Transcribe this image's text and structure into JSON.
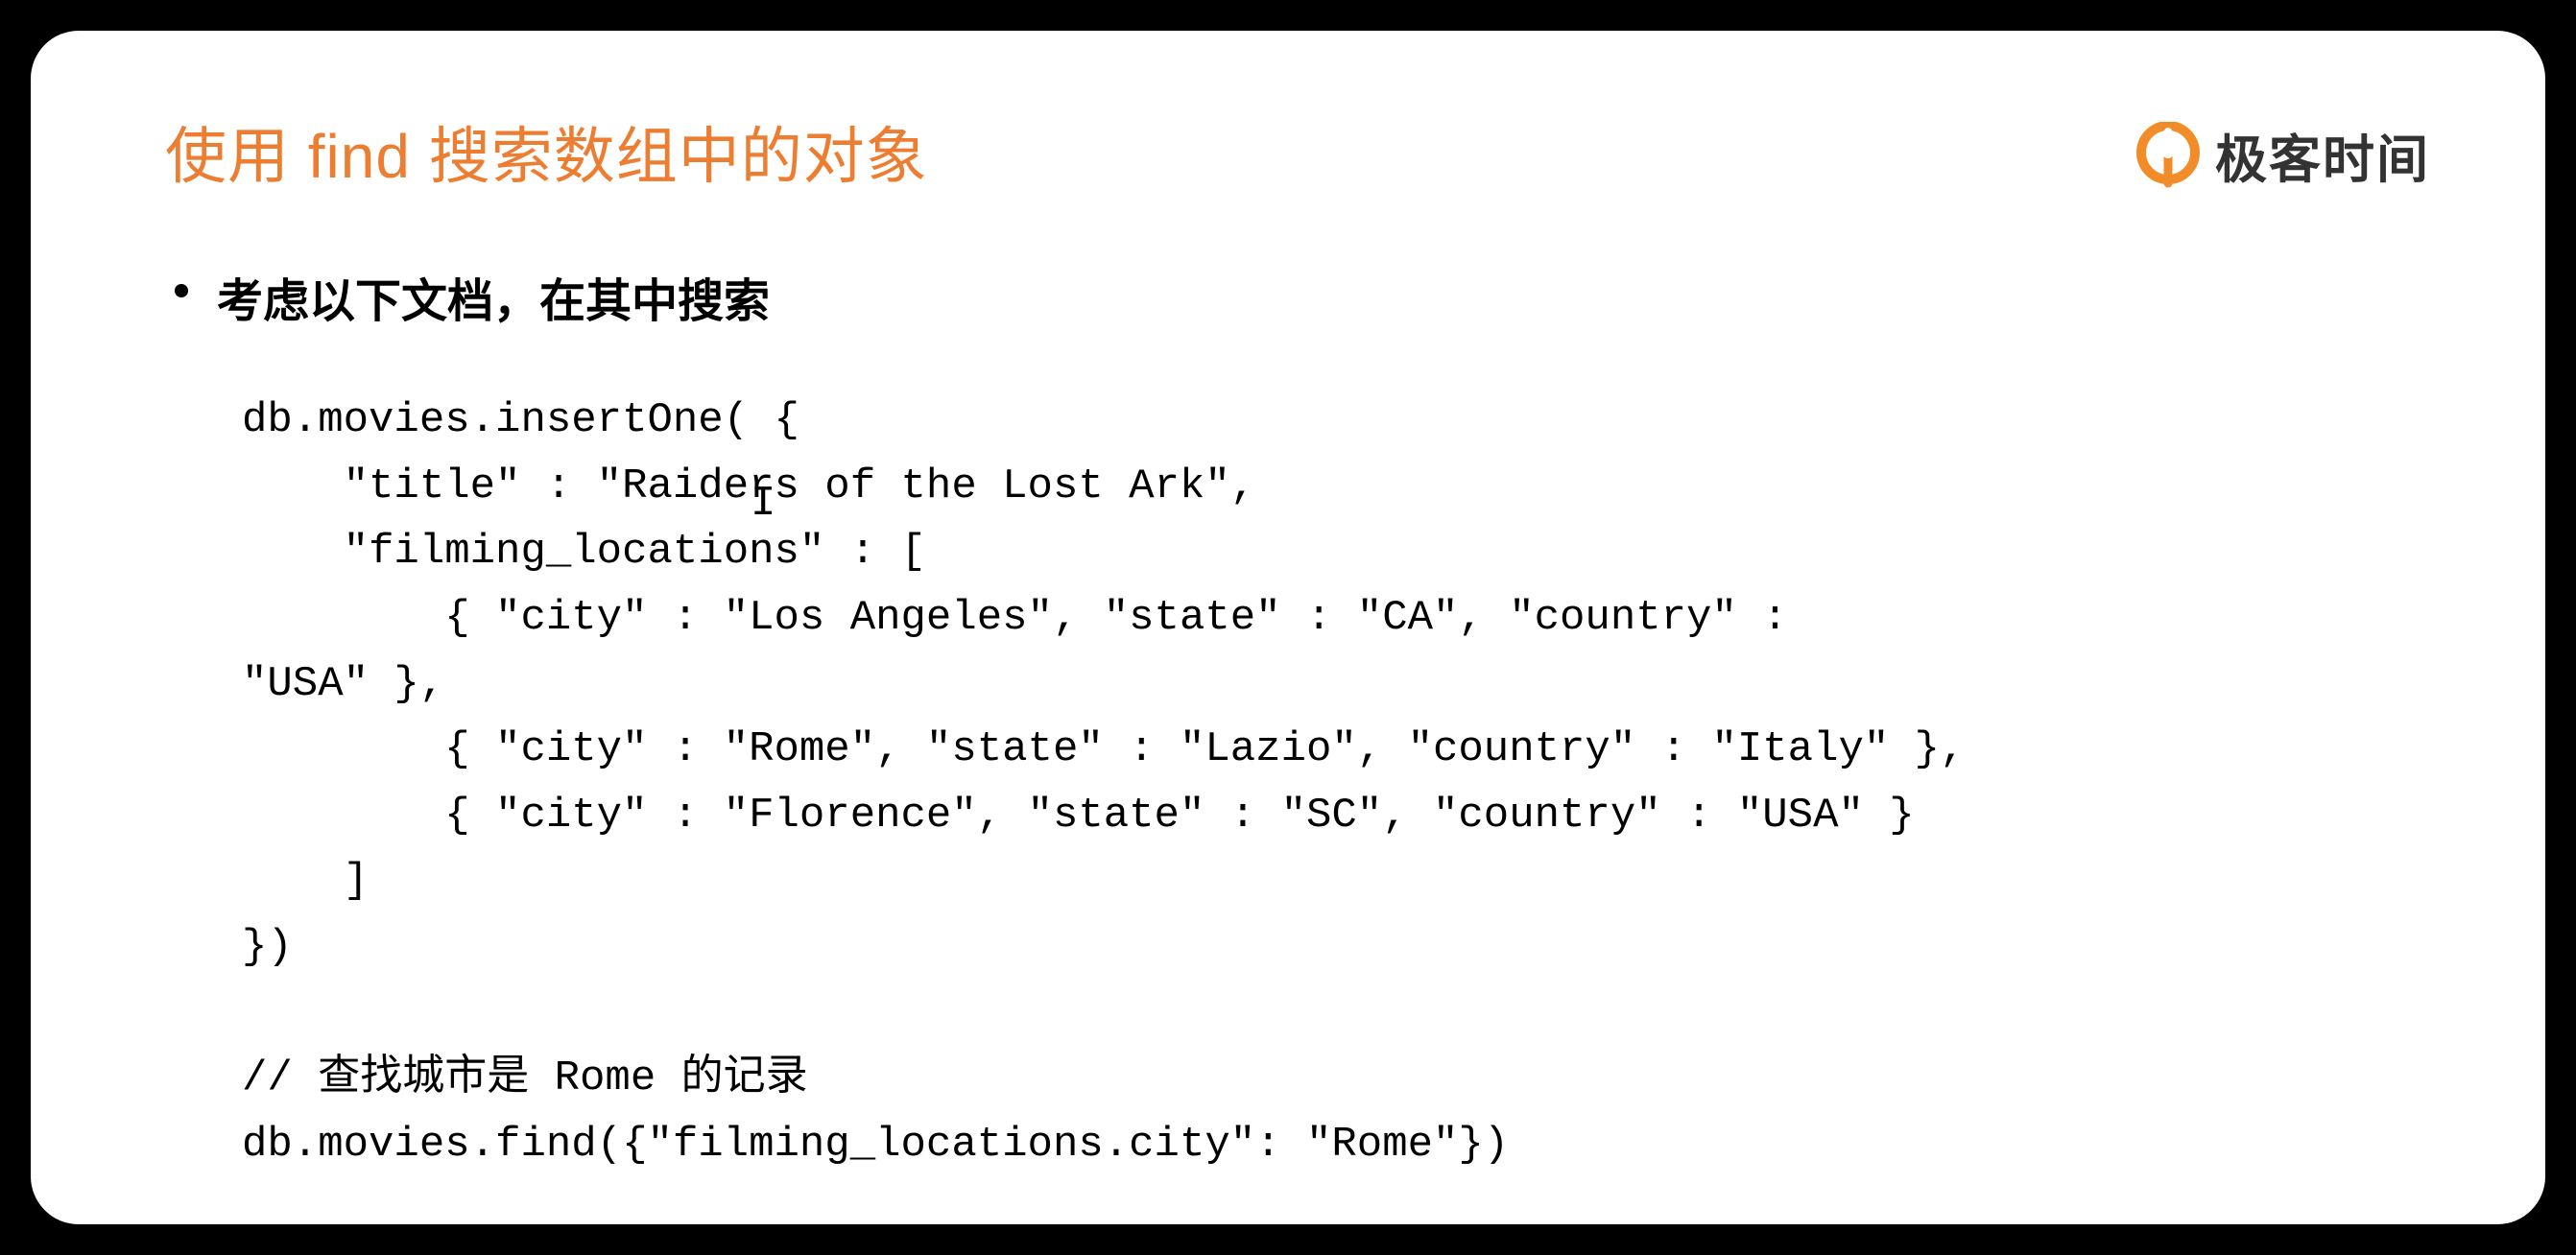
{
  "title": "使用 find 搜索数组中的对象",
  "logo": {
    "text": "极客时间",
    "icon_name": "geekbang-logo-icon"
  },
  "bullet": "考虑以下文档，在其中搜索",
  "code": "db.movies.insertOne( {\n    \"title\" : \"Raiders of the Lost Ark\",\n    \"filming_locations\" : [\n        { \"city\" : \"Los Angeles\", \"state\" : \"CA\", \"country\" :\n\"USA\" },\n        { \"city\" : \"Rome\", \"state\" : \"Lazio\", \"country\" : \"Italy\" },\n        { \"city\" : \"Florence\", \"state\" : \"SC\", \"country\" : \"USA\" }\n    ]\n})\n\n// 查找城市是 Rome 的记录\ndb.movies.find({\"filming_locations.city\": \"Rome\"})"
}
